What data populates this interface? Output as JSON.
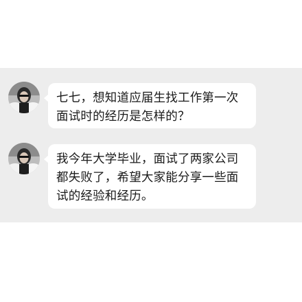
{
  "chat": {
    "messages": [
      {
        "avatar_icon": "user-avatar-icon",
        "text": "七七，想知道应届生找工作第一次面试时的经历是怎样的？"
      },
      {
        "avatar_icon": "user-avatar-icon",
        "text": "我今年大学毕业，面试了两家公司都失败了，希望大家能分享一些面试的经验和经历。"
      }
    ]
  },
  "colors": {
    "page_background": "#ffffff",
    "chat_background": "#ededed",
    "bubble_background": "#ffffff",
    "text": "#1a1a1a"
  }
}
